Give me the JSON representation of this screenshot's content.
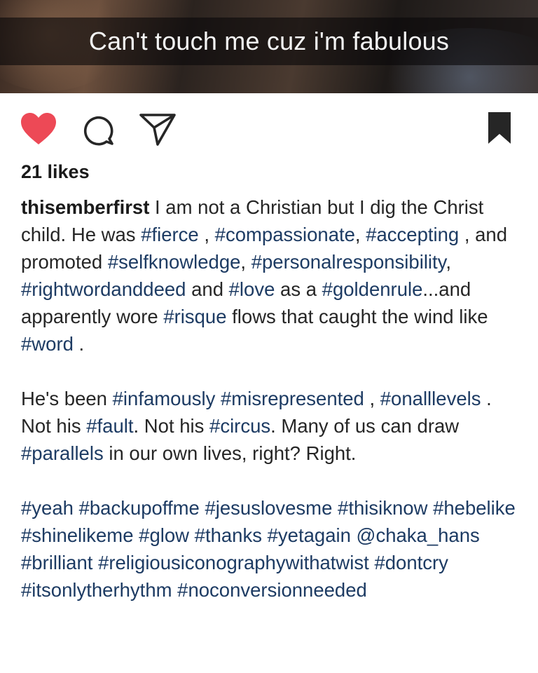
{
  "photo": {
    "overlay_text": "Can't touch me cuz i'm fabulous"
  },
  "actions": {
    "like_icon": "heart-filled-icon",
    "comment_icon": "comment-bubble-icon",
    "share_icon": "send-paper-plane-icon",
    "save_icon": "bookmark-filled-icon",
    "like_color": "#ed4956"
  },
  "likes": "21 likes",
  "caption": {
    "username": "thisemberfirst",
    "paragraphs": [
      [
        {
          "t": "text",
          "v": " I am not a Christian but I dig the Christ child.  He was "
        },
        {
          "t": "tag",
          "v": "#fierce"
        },
        {
          "t": "text",
          "v": " , "
        },
        {
          "t": "tag",
          "v": "#compassionate"
        },
        {
          "t": "text",
          "v": ", "
        },
        {
          "t": "tag",
          "v": "#accepting"
        },
        {
          "t": "text",
          "v": " , and promoted "
        },
        {
          "t": "tag",
          "v": "#selfknowledge"
        },
        {
          "t": "text",
          "v": ", "
        },
        {
          "t": "tag",
          "v": "#personalresponsibility"
        },
        {
          "t": "text",
          "v": ", "
        },
        {
          "t": "tag",
          "v": "#rightwordanddeed"
        },
        {
          "t": "text",
          "v": " and "
        },
        {
          "t": "tag",
          "v": "#love"
        },
        {
          "t": "text",
          "v": " as a "
        },
        {
          "t": "tag",
          "v": "#goldenrule"
        },
        {
          "t": "text",
          "v": "...and apparently wore "
        },
        {
          "t": "tag",
          "v": "#risque"
        },
        {
          "t": "text",
          "v": " flows that caught the wind like "
        },
        {
          "t": "tag",
          "v": "#word"
        },
        {
          "t": "text",
          "v": " ."
        }
      ],
      [
        {
          "t": "text",
          "v": "He's been "
        },
        {
          "t": "tag",
          "v": "#infamously"
        },
        {
          "t": "text",
          "v": " "
        },
        {
          "t": "tag",
          "v": "#misrepresented"
        },
        {
          "t": "text",
          "v": " , "
        },
        {
          "t": "tag",
          "v": "#onalllevels"
        },
        {
          "t": "text",
          "v": " . Not his "
        },
        {
          "t": "tag",
          "v": "#fault"
        },
        {
          "t": "text",
          "v": ".  Not his "
        },
        {
          "t": "tag",
          "v": "#circus"
        },
        {
          "t": "text",
          "v": ".  Many of us can draw "
        },
        {
          "t": "tag",
          "v": "#parallels"
        },
        {
          "t": "text",
          "v": " in our own lives, right? Right."
        }
      ],
      [
        {
          "t": "tag",
          "v": "#yeah"
        },
        {
          "t": "text",
          "v": " "
        },
        {
          "t": "tag",
          "v": "#backupoffme"
        },
        {
          "t": "text",
          "v": " "
        },
        {
          "t": "tag",
          "v": "#jesuslovesme"
        },
        {
          "t": "text",
          "v": " "
        },
        {
          "t": "tag",
          "v": "#thisiknow"
        },
        {
          "t": "text",
          "v": " "
        },
        {
          "t": "tag",
          "v": "#hebelike"
        },
        {
          "t": "text",
          "v": " "
        },
        {
          "t": "tag",
          "v": "#shinelikeme"
        },
        {
          "t": "text",
          "v": " "
        },
        {
          "t": "tag",
          "v": "#glow"
        },
        {
          "t": "text",
          "v": " "
        },
        {
          "t": "tag",
          "v": "#thanks"
        },
        {
          "t": "text",
          "v": " "
        },
        {
          "t": "tag",
          "v": "#yetagain"
        },
        {
          "t": "text",
          "v": " "
        },
        {
          "t": "tag",
          "v": "@chaka_hans"
        },
        {
          "t": "text",
          "v": " "
        },
        {
          "t": "tag",
          "v": "#brilliant"
        },
        {
          "t": "text",
          "v": " "
        },
        {
          "t": "tag",
          "v": "#religiousiconographywithatwist"
        },
        {
          "t": "text",
          "v": " "
        },
        {
          "t": "tag",
          "v": "#dontcry"
        },
        {
          "t": "text",
          "v": " "
        },
        {
          "t": "tag",
          "v": "#itsonlytherhythm"
        },
        {
          "t": "text",
          "v": " "
        },
        {
          "t": "tag",
          "v": "#noconversionneeded"
        }
      ]
    ]
  }
}
